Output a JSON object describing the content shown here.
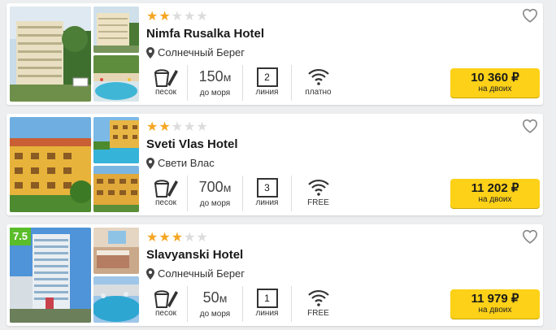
{
  "hotels": [
    {
      "name": "Nimfa Rusalka Hotel",
      "stars": 2,
      "location": "Солнечный Берег",
      "beach_label": "песок",
      "distance_value": "150",
      "distance_unit": "м",
      "distance_label": "до моря",
      "line_value": "2",
      "line_label": "линия",
      "wifi_label": "платно",
      "price": "10 360 ₽",
      "price_note": "на двоих",
      "rating": ""
    },
    {
      "name": "Sveti Vlas Hotel",
      "stars": 2,
      "location": "Свети Влас",
      "beach_label": "песок",
      "distance_value": "700",
      "distance_unit": "м",
      "distance_label": "до моря",
      "line_value": "3",
      "line_label": "линия",
      "wifi_label": "FREE",
      "price": "11 202 ₽",
      "price_note": "на двоих",
      "rating": ""
    },
    {
      "name": "Slavyanski Hotel",
      "stars": 3,
      "location": "Солнечный Берег",
      "beach_label": "песок",
      "distance_value": "50",
      "distance_unit": "м",
      "distance_label": "до моря",
      "line_value": "1",
      "line_label": "линия",
      "wifi_label": "FREE",
      "price": "11 979 ₽",
      "price_note": "на двоих",
      "rating": "7.5"
    }
  ],
  "icons": {
    "favorite": "heart-outline-icon",
    "location": "map-pin-icon",
    "beach": "sand-bucket-icon",
    "wifi": "wifi-icon",
    "star": "star-icon"
  },
  "colors": {
    "star_on": "#f5a623",
    "star_off": "#dcdcdc",
    "price_button": "#fcd118",
    "rating_badge": "#5bbd2b"
  }
}
